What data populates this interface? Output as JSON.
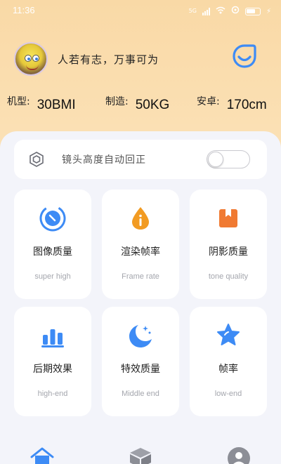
{
  "status": {
    "time": "11:36",
    "net": "5G"
  },
  "profile": {
    "motto": "人若有志，万事可为"
  },
  "specs": [
    {
      "label": "机型:",
      "value": "30BMI"
    },
    {
      "label": "制造:",
      "value": "50KG"
    },
    {
      "label": "安卓:",
      "value": "170cm"
    }
  ],
  "toggle": {
    "label": "镜头高度自动回正",
    "on": false
  },
  "cards": [
    {
      "title": "图像质量",
      "sub": "super high",
      "icon": "gauge-icon"
    },
    {
      "title": "渲染帧率",
      "sub": "Frame rate",
      "icon": "drop-icon"
    },
    {
      "title": "阴影质量",
      "sub": "tone quality",
      "icon": "bookmark-box-icon"
    },
    {
      "title": "后期效果",
      "sub": "high-end",
      "icon": "bar-chart-icon"
    },
    {
      "title": "特效质量",
      "sub": "Middle end",
      "icon": "moon-icon"
    },
    {
      "title": "帧率",
      "sub": "low-end",
      "icon": "star-icon"
    }
  ],
  "colors": {
    "accent_blue": "#3d8bf5",
    "accent_orange": "#f29b22",
    "panel_bg": "#f3f4fa",
    "header_bg": "#fbe0b4"
  }
}
